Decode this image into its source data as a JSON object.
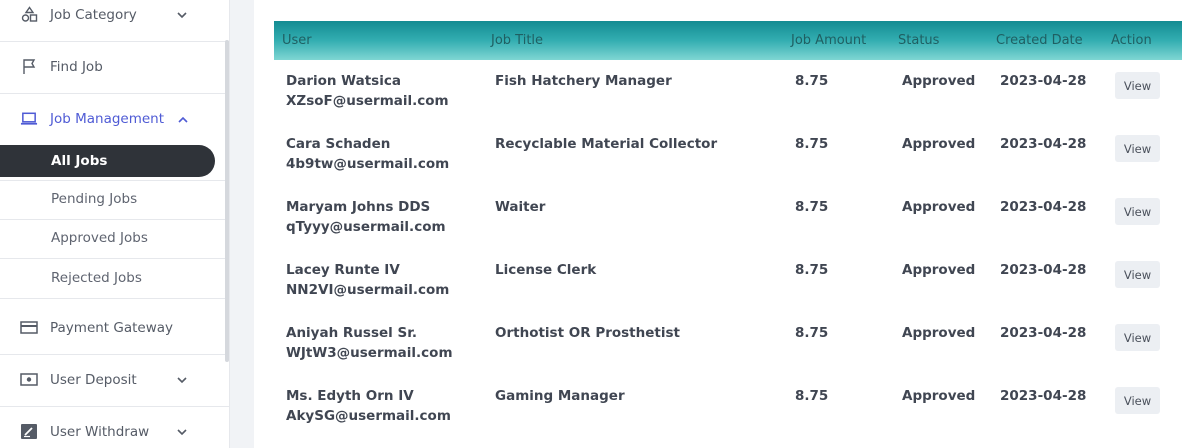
{
  "sidebar": {
    "items": [
      {
        "label": "Job Category",
        "icon": "shapes-icon",
        "chevron": "down"
      },
      {
        "label": "Find Job",
        "icon": "flag-icon"
      },
      {
        "label": "Job Management",
        "icon": "laptop-icon",
        "chevron": "up",
        "active": true
      },
      {
        "label": "Payment Gateway",
        "icon": "credit-card-icon"
      },
      {
        "label": "User Deposit",
        "icon": "cash-icon",
        "chevron": "down"
      },
      {
        "label": "User Withdraw",
        "icon": "edit-icon",
        "chevron": "down"
      }
    ],
    "submenu": [
      {
        "label": "All Jobs",
        "active": true
      },
      {
        "label": "Pending Jobs"
      },
      {
        "label": "Approved Jobs"
      },
      {
        "label": "Rejected Jobs"
      }
    ]
  },
  "table": {
    "headers": [
      "User",
      "Job Title",
      "Job Amount",
      "Status",
      "Created Date",
      "Action"
    ],
    "rows": [
      {
        "name": "Darion Watsica",
        "email": "XZsoF@usermail.com",
        "title": "Fish Hatchery Manager",
        "amount": "8.75",
        "status": "Approved",
        "date": "2023-04-28",
        "action": "View"
      },
      {
        "name": "Cara Schaden",
        "email": "4b9tw@usermail.com",
        "title": "Recyclable Material Collector",
        "amount": "8.75",
        "status": "Approved",
        "date": "2023-04-28",
        "action": "View"
      },
      {
        "name": "Maryam Johns DDS",
        "email": "qTyyy@usermail.com",
        "title": "Waiter",
        "amount": "8.75",
        "status": "Approved",
        "date": "2023-04-28",
        "action": "View"
      },
      {
        "name": "Lacey Runte IV",
        "email": "NN2VI@usermail.com",
        "title": "License Clerk",
        "amount": "8.75",
        "status": "Approved",
        "date": "2023-04-28",
        "action": "View"
      },
      {
        "name": "Aniyah Russel Sr.",
        "email": "WJtW3@usermail.com",
        "title": "Orthotist OR Prosthetist",
        "amount": "8.75",
        "status": "Approved",
        "date": "2023-04-28",
        "action": "View"
      },
      {
        "name": "Ms. Edyth Orn IV",
        "email": "AkySG@usermail.com",
        "title": "Gaming Manager",
        "amount": "8.75",
        "status": "Approved",
        "date": "2023-04-28",
        "action": "View"
      }
    ]
  },
  "colors": {
    "accent": "#4f5bd5",
    "header_gradient_top": "#138b92",
    "header_gradient_bottom": "#7fd6d3",
    "active_submenu_bg": "#2f3339"
  }
}
